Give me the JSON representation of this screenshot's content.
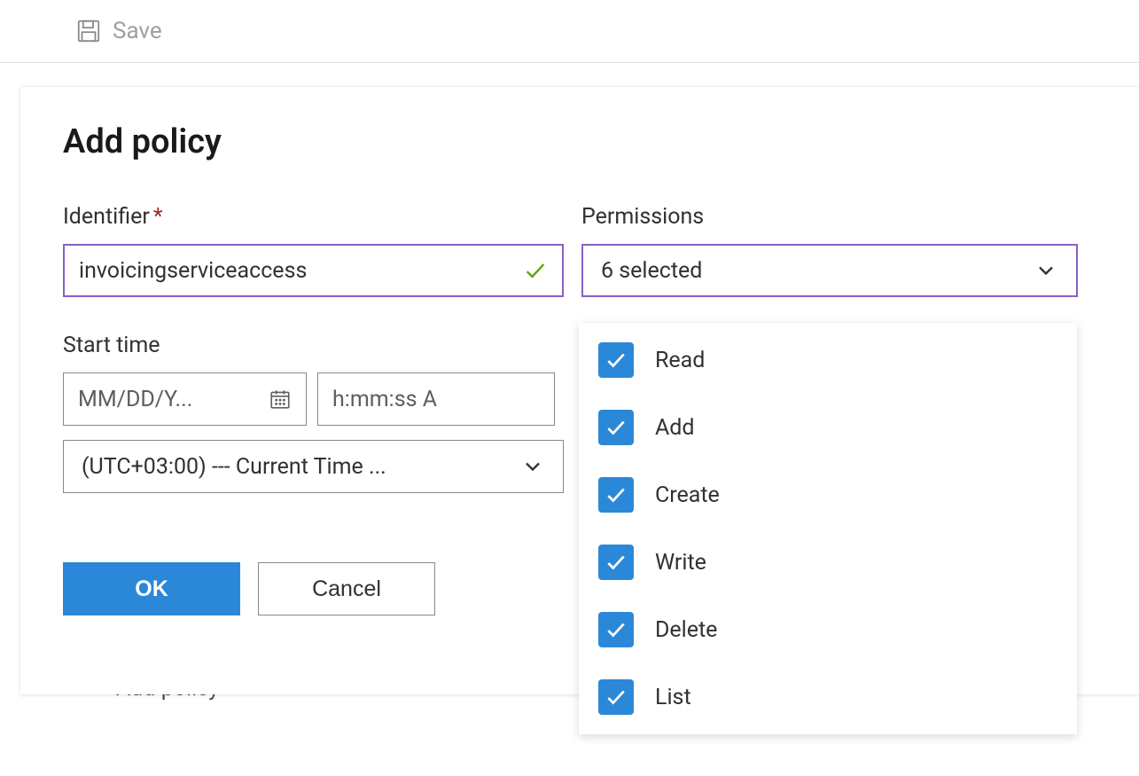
{
  "toolbar": {
    "save_label": "Save"
  },
  "panel": {
    "title": "Add policy",
    "identifier_label": "Identifier",
    "identifier_value": "invoicingserviceaccess",
    "permissions_label": "Permissions",
    "permissions_selected_text": "6 selected",
    "permissions_options": [
      {
        "label": "Read",
        "checked": true
      },
      {
        "label": "Add",
        "checked": true
      },
      {
        "label": "Create",
        "checked": true
      },
      {
        "label": "Write",
        "checked": true
      },
      {
        "label": "Delete",
        "checked": true
      },
      {
        "label": "List",
        "checked": true
      }
    ],
    "start_time_label": "Start time",
    "date_placeholder": "MM/DD/Y...",
    "time_placeholder": "h:mm:ss A",
    "timezone_display": "(UTC+03:00) --- Current Time ...",
    "ok_label": "OK",
    "cancel_label": "Cancel"
  },
  "background": {
    "add_policy_label": "Add policy"
  }
}
